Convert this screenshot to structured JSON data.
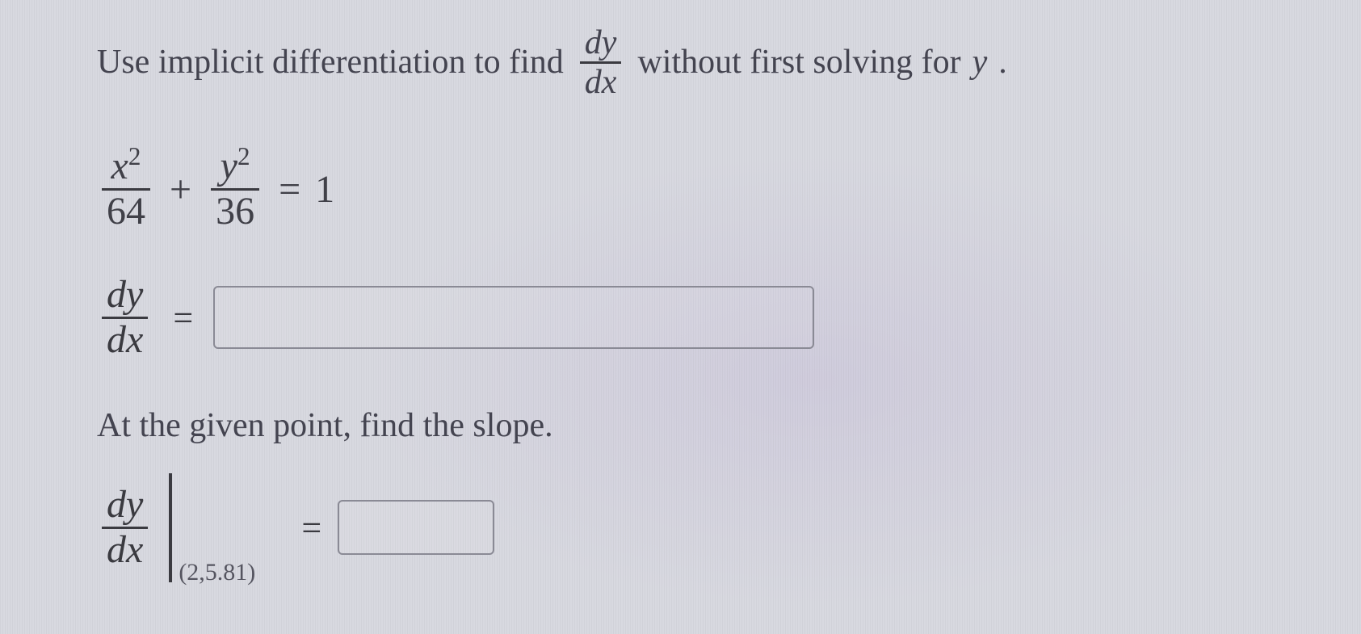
{
  "problem": {
    "intro_pre": "Use implicit differentiation to find",
    "deriv_num": "dy",
    "deriv_den": "dx",
    "intro_post": "without first solving for",
    "intro_var": "y",
    "intro_period": "."
  },
  "equation": {
    "term1_num": "x",
    "term1_exp": "2",
    "term1_den": "64",
    "plus": "+",
    "term2_num": "y",
    "term2_exp": "2",
    "term2_den": "36",
    "equals": "=",
    "rhs": "1"
  },
  "answer1": {
    "lhs_num": "dy",
    "lhs_den": "dx",
    "equals": "=",
    "value": ""
  },
  "subhead": "At the given point, find the slope.",
  "answer2": {
    "lhs_num": "dy",
    "lhs_den": "dx",
    "point": "(2,5.81)",
    "equals": "=",
    "value": ""
  }
}
